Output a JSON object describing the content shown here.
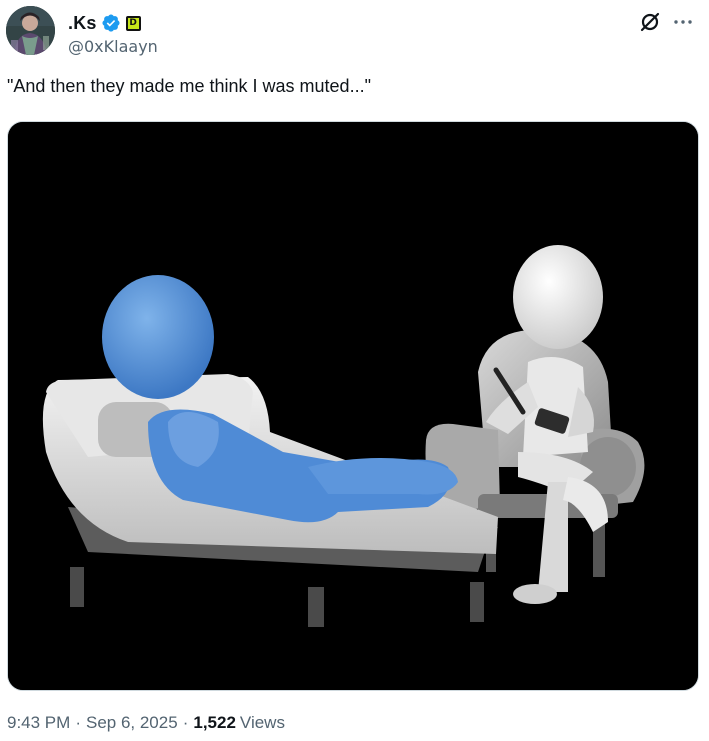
{
  "author": {
    "display_name": ".Ks",
    "handle": "@0xKlaayn",
    "verified": true,
    "affiliate_badge_letter": "D",
    "verified_color": "#1d9bf0",
    "affiliate_badge_color": "#c6e51a"
  },
  "tweet": {
    "text": "\"And then they made me think I was muted...\""
  },
  "meta": {
    "time": "9:43 PM",
    "separator": "·",
    "date": "Sep 6, 2025",
    "views_count": "1,522",
    "views_label": "Views"
  },
  "icons": {
    "grok": "grok-icon",
    "more": "more-icon"
  }
}
